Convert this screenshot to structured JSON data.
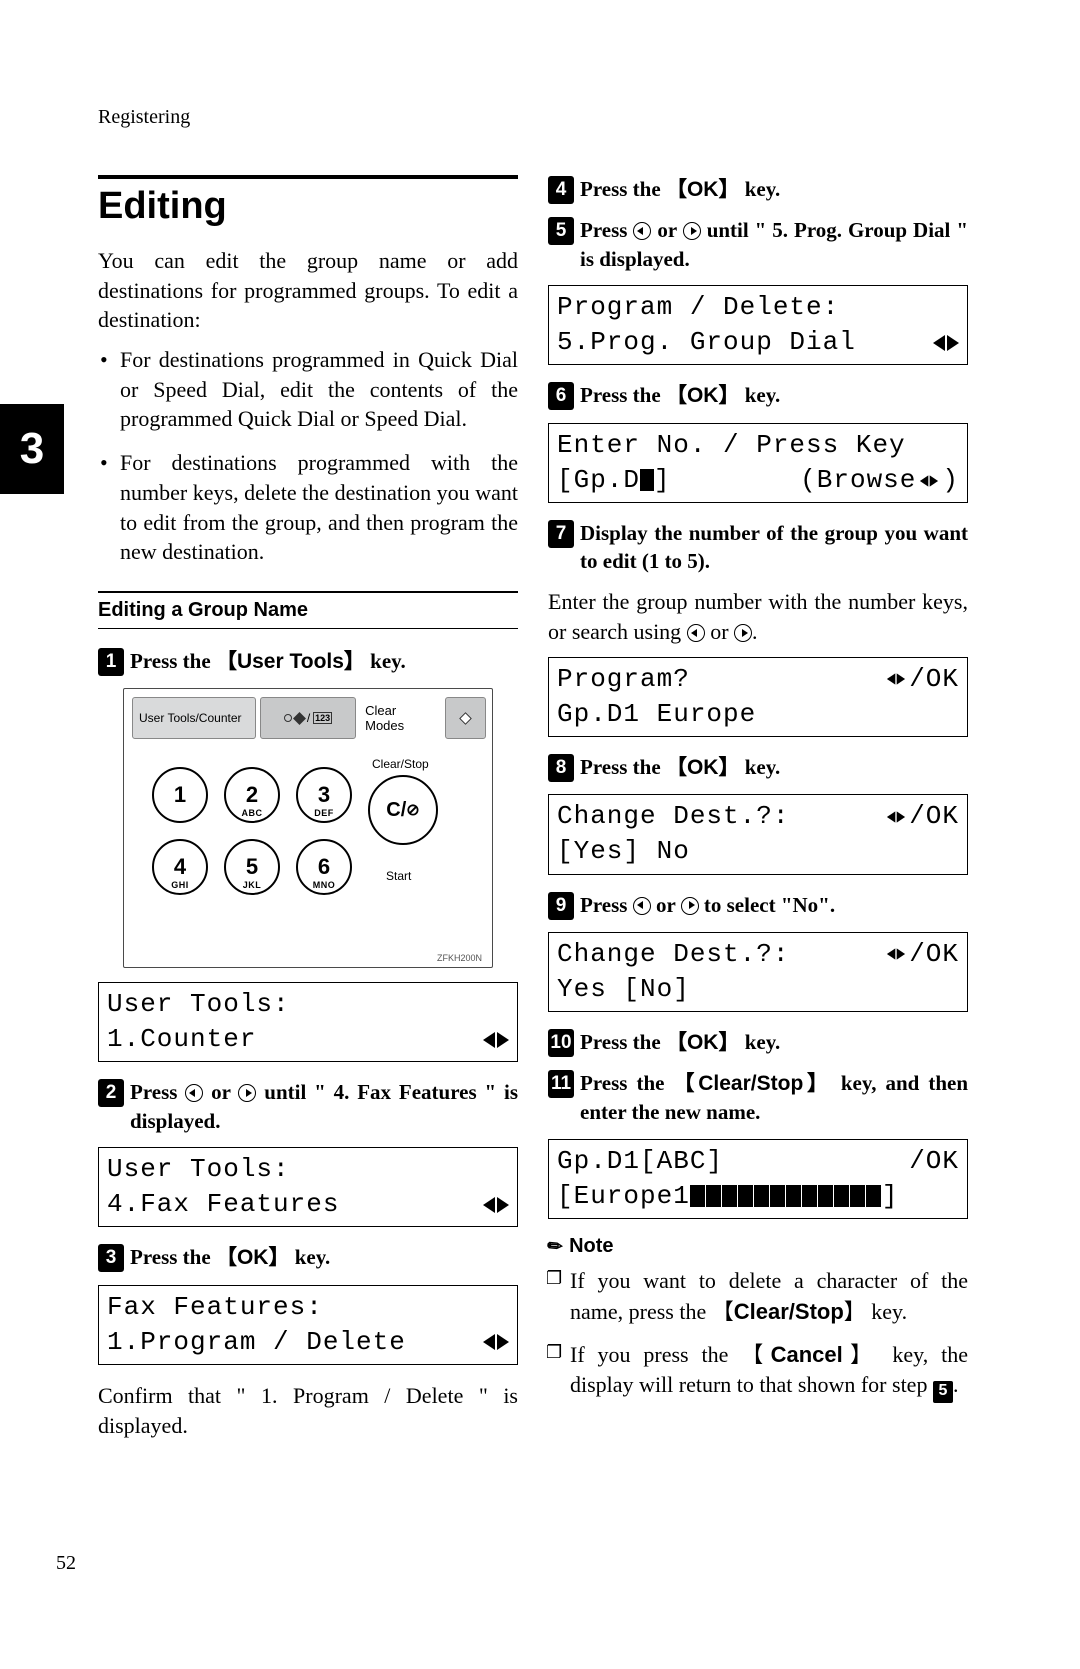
{
  "header": "Registering",
  "chapter_tab": "3",
  "page_number": "52",
  "section_title": "Editing",
  "intro": "You can edit the group name or add destinations for programmed groups. To edit a destination:",
  "bullets": [
    "For destinations programmed in Quick Dial or Speed Dial, edit the contents of the programmed Quick Dial or Speed Dial.",
    "For destinations programmed with the number keys, delete the destination you want to edit from the group, and then program the new destination."
  ],
  "subheading": "Editing a Group Name",
  "step1": {
    "pre": "Press the ",
    "key": "User Tools",
    "post": " key."
  },
  "keypad": {
    "head_left": "User Tools/Counter",
    "clear_modes": "Clear Modes",
    "clear_stop": "Clear/Stop",
    "cs_key": "C/",
    "start": "Start",
    "keys": [
      {
        "n": "1",
        "s": ""
      },
      {
        "n": "2",
        "s": "ABC"
      },
      {
        "n": "3",
        "s": "DEF"
      },
      {
        "n": "4",
        "s": "GHI"
      },
      {
        "n": "5",
        "s": "JKL"
      },
      {
        "n": "6",
        "s": "MNO"
      }
    ],
    "ref": "ZFKH200N"
  },
  "lcd1": {
    "l1": "User Tools:",
    "l2": "1.Counter"
  },
  "step2": {
    "pre": "Press ",
    "mid": " or ",
    "post": " until \" 4. Fax Features \" is displayed."
  },
  "lcd2": {
    "l1": "User Tools:",
    "l2": "4.Fax Features"
  },
  "step3": {
    "pre": "Press the ",
    "key": "OK",
    "post": " key."
  },
  "lcd3": {
    "l1": "Fax Features:",
    "l2": "1.Program / Delete"
  },
  "confirm_text": "Confirm that \" 1. Program / Delete \" is displayed.",
  "step4": {
    "pre": "Press the ",
    "key": "OK",
    "post": " key."
  },
  "step5": {
    "pre": "Press ",
    "mid": " or ",
    "post": " until \" 5. Prog. Group Dial \" is displayed."
  },
  "lcd5": {
    "l1": "Program / Delete:",
    "l2": "5.Prog. Group Dial"
  },
  "step6": {
    "pre": "Press the ",
    "key": "OK",
    "post": " key."
  },
  "lcd6": {
    "l1": "Enter No. / Press Key",
    "l2a": "[Gp.D",
    "l2b": "]",
    "l2c": "(Browse",
    "l2d": ")"
  },
  "step7": "Display the number of the group you want to edit (1 to 5).",
  "step7_sub": "Enter the group number with the number keys, or search using ",
  "step7_sub_mid": " or ",
  "step7_sub_end": ".",
  "lcd7": {
    "l1a": "Program?",
    "l1b": "/OK",
    "l2": "Gp.D1 Europe"
  },
  "step8": {
    "pre": "Press the ",
    "key": "OK",
    "post": " key."
  },
  "lcd8": {
    "l1a": "Change Dest.?:",
    "l1b": "/OK",
    "l2": " [Yes]   No"
  },
  "step9": {
    "pre": "Press ",
    "mid": " or ",
    "post": " to select \"No\"."
  },
  "lcd9": {
    "l1a": "Change Dest.?:",
    "l1b": "/OK",
    "l2": "  Yes   [No]"
  },
  "step10": {
    "pre": "Press the ",
    "key": "OK",
    "post": " key."
  },
  "step11": {
    "pre": "Press the ",
    "key": "Clear/Stop",
    "post": " key, and then enter the new name."
  },
  "lcd11": {
    "l1a": "Gp.D1[ABC]",
    "l1b": "/OK",
    "l2a": "[Europe1"
  },
  "note_label": "Note",
  "notes": [
    {
      "pre": "If you want to delete a character of the name, press the ",
      "key": "Clear/Stop",
      "post": " key."
    },
    {
      "pre": "If you press the ",
      "key": "Cancel",
      "post": " key, the display will return to that shown for step ",
      "ref": "5",
      "tail": "."
    }
  ]
}
